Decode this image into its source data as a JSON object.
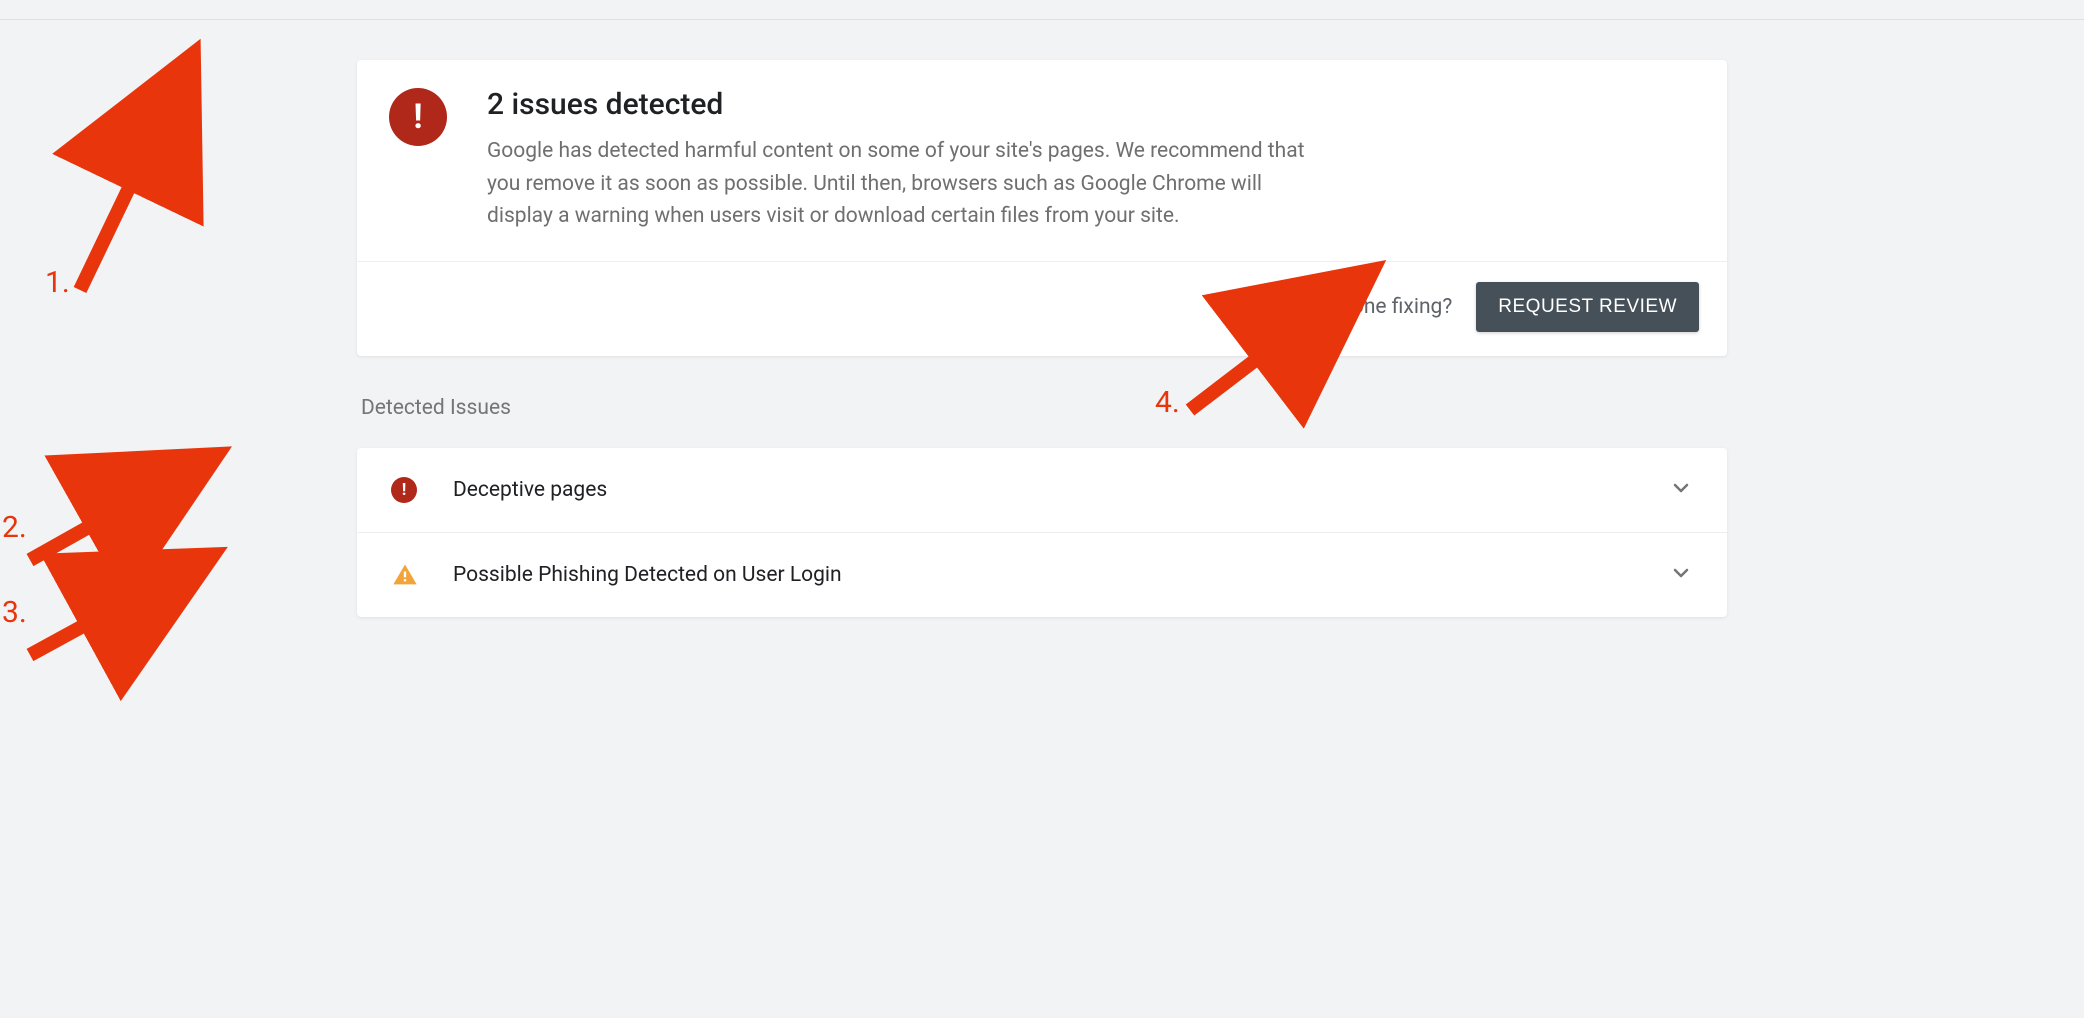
{
  "alert": {
    "title": "2 issues detected",
    "description": "Google has detected harmful content on some of your site's pages. We recommend that you remove it as soon as possible. Until then, browsers such as Google Chrome will display a warning when users visit or download certain files from your site."
  },
  "footer": {
    "done_fixing_label": "Done fixing?",
    "request_review_label": "REQUEST REVIEW"
  },
  "section_title": "Detected Issues",
  "issues": [
    {
      "label": "Deceptive pages",
      "severity": "error"
    },
    {
      "label": "Possible Phishing Detected on User Login",
      "severity": "warning"
    }
  ],
  "annotations": {
    "1": "1.",
    "2": "2.",
    "3": "3.",
    "4": "4."
  }
}
